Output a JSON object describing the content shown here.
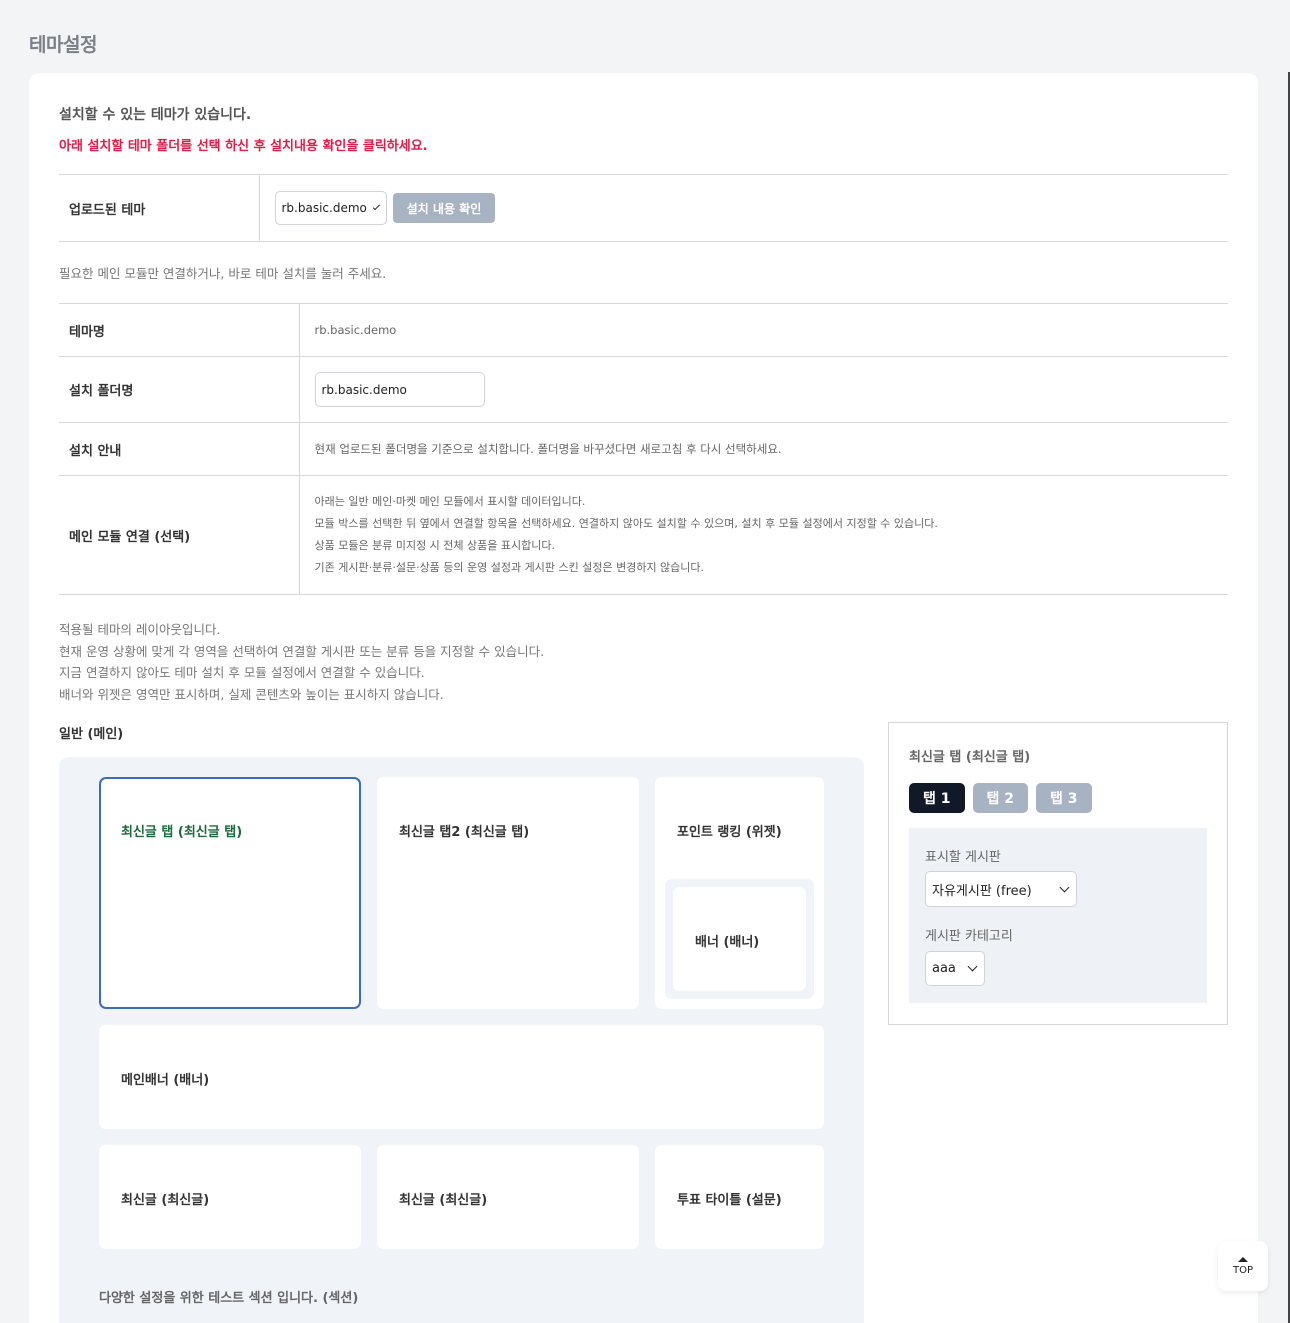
{
  "page_title": "테마설정",
  "intro": {
    "line1": "설치할 수 있는 테마가 있습니다.",
    "line2": "아래 설치할 테마 폴더를 선택 하신 후 설치내용 확인을 클릭하세요."
  },
  "upload": {
    "label": "업로드된 테마",
    "selected_theme": "rb.basic.demo",
    "confirm_button": "설치 내용 확인"
  },
  "note": "필요한 메인 모듈만 연결하거나, 바로 테마 설치를 눌러 주세요.",
  "theme_info": {
    "name_label": "테마명",
    "name_value": "rb.basic.demo",
    "folder_label": "설치 폴더명",
    "folder_value": "rb.basic.demo",
    "guide_label": "설치 안내",
    "guide_value": "현재 업로드된 폴더명을 기준으로 설치합니다. 폴더명을 바꾸셨다면 새로고침 후 다시 선택하세요.",
    "module_label": "메인 모듈 연결 (선택)",
    "module_lines": [
      "아래는 일반 메인·마켓 메인 모듈에서 표시할 데이터입니다.",
      "모듈 박스를 선택한 뒤 옆에서 연결할 항목을 선택하세요. 연결하지 않아도 설치할 수 있으며, 설치 후 모듈 설정에서 지정할 수 있습니다.",
      "상품 모듈은 분류 미지정 시 전체 상품을 표시합니다.",
      "기존 게시판·분류·설문·상품 등의 운영 설정과 게시판 스킨 설정은 변경하지 않습니다."
    ]
  },
  "layout_desc": [
    "적용될 테마의 레이아웃입니다.",
    "현재 운영 상황에 맞게 각 영역을 선택하여 연결할 게시판 또는 분류 등을 지정할 수 있습니다.",
    "지금 연결하지 않아도 테마 설치 후 모듈 설정에서 연결할 수 있습니다.",
    "배너와 위젯은 영역만 표시하며, 실제 콘텐츠와 높이는 표시하지 않습니다."
  ],
  "layout": {
    "section_label": "일반 (메인)",
    "modules": {
      "latest_tab": "최신글 탭 (최신글 탭)",
      "latest_tab2": "최신글 탭2 (최신글 탭)",
      "point_ranking": "포인트 랭킹 (위젯)",
      "banner": "배너 (배너)",
      "main_banner": "메인배너 (배너)",
      "latest1": "최신글 (최신글)",
      "latest2": "최신글 (최신글)",
      "poll": "투표 타이틀 (설문)"
    },
    "section_caption": "다양한 설정을 위한 테스트 섹션 입니다. (섹션)"
  },
  "panel": {
    "title": "최신글 탭 (최신글 탭)",
    "tabs": [
      "탭 1",
      "탭 2",
      "탭 3"
    ],
    "active_tab": "탭 1",
    "board_label": "표시할 게시판",
    "board_value": "자유게시판 (free)",
    "category_label": "게시판 카테고리",
    "category_value": "aaa"
  },
  "top_button": "TOP",
  "colors": {
    "accent_red": "#e11d48",
    "selected_border": "#3b6dbf",
    "selected_text": "#1b6b3a",
    "tab_active": "#111827",
    "tab_inactive": "#a7b2c2"
  }
}
